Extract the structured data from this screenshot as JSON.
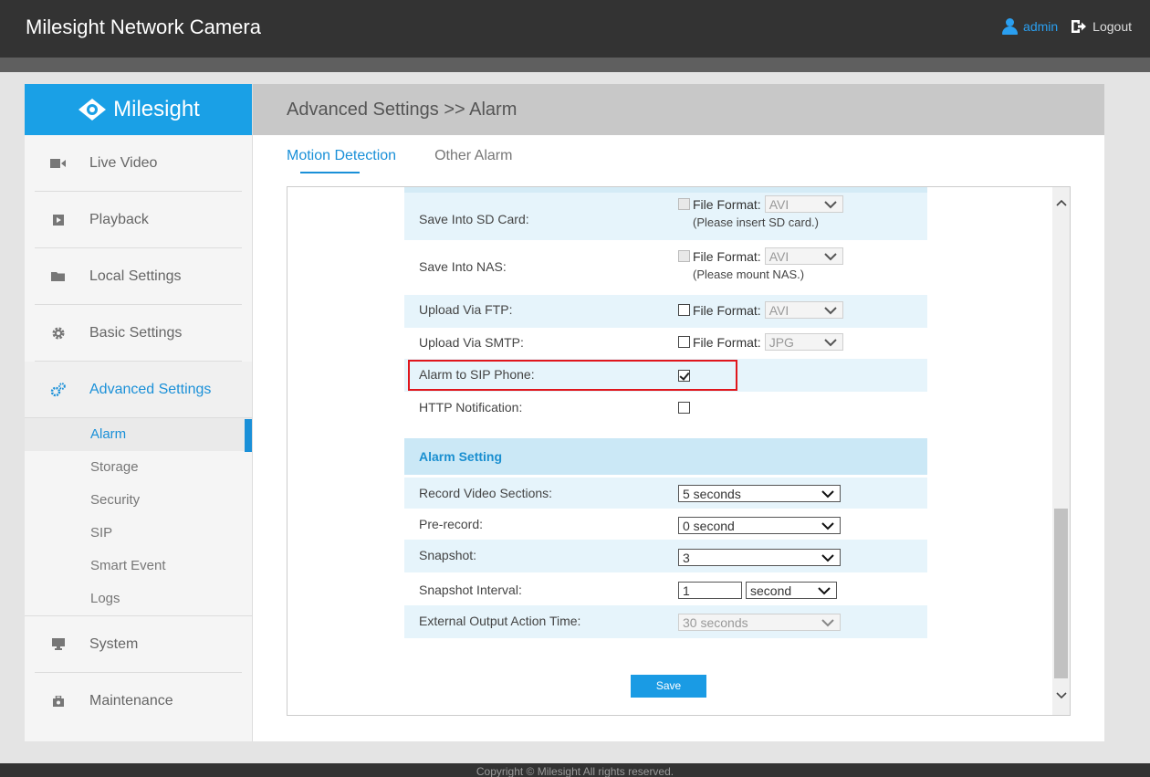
{
  "app": {
    "title": "Milesight Network Camera",
    "brand": "Milesight"
  },
  "user": {
    "name": "admin",
    "logout_label": "Logout"
  },
  "colors": {
    "accent": "#1aa0e6",
    "topbar": "#333333",
    "highlight": "#e0161c",
    "row_alt": "#e6f4fb",
    "section": "#cbe8f6"
  },
  "sidebar": {
    "items": [
      {
        "label": "Live Video",
        "icon": "video-camera-icon"
      },
      {
        "label": "Playback",
        "icon": "play-icon"
      },
      {
        "label": "Local Settings",
        "icon": "folder-icon"
      },
      {
        "label": "Basic Settings",
        "icon": "gear-icon"
      },
      {
        "label": "Advanced Settings",
        "icon": "gears-icon",
        "active": true
      },
      {
        "label": "System",
        "icon": "monitor-icon"
      },
      {
        "label": "Maintenance",
        "icon": "toolbox-icon"
      }
    ],
    "sub_items": [
      {
        "label": "Alarm",
        "active": true
      },
      {
        "label": "Storage"
      },
      {
        "label": "Security"
      },
      {
        "label": "SIP"
      },
      {
        "label": "Smart Event"
      },
      {
        "label": "Logs"
      }
    ]
  },
  "main": {
    "breadcrumb": "Advanced Settings >> Alarm",
    "tabs": [
      {
        "label": "Motion Detection",
        "active": true
      },
      {
        "label": "Other Alarm"
      }
    ]
  },
  "form": {
    "file_format_label": "File Format:",
    "save_sd": {
      "label": "Save Into SD Card:",
      "format": "AVI",
      "note": "(Please insert SD card.)",
      "checked": false,
      "disabled": true
    },
    "save_nas": {
      "label": "Save Into NAS:",
      "format": "AVI",
      "note": "(Please mount NAS.)",
      "checked": false,
      "disabled": true
    },
    "upload_ftp": {
      "label": "Upload Via FTP:",
      "format": "AVI",
      "checked": false
    },
    "upload_smtp": {
      "label": "Upload Via SMTP:",
      "format": "JPG",
      "checked": false
    },
    "sip_phone": {
      "label": "Alarm to SIP Phone:",
      "checked": true
    },
    "http_notify": {
      "label": "HTTP Notification:",
      "checked": false
    },
    "alarm_setting": {
      "title": "Alarm Setting",
      "record_sections": {
        "label": "Record Video Sections:",
        "value": "5 seconds"
      },
      "pre_record": {
        "label": "Pre-record:",
        "value": "0 second"
      },
      "snapshot": {
        "label": "Snapshot:",
        "value": "3"
      },
      "snapshot_interval": {
        "label": "Snapshot Interval:",
        "value": "1",
        "unit": "second"
      },
      "external_output": {
        "label": "External Output Action Time:",
        "value": "30 seconds"
      }
    },
    "save_label": "Save"
  },
  "footer": {
    "copyright": "Copyright © Milesight All rights reserved."
  }
}
